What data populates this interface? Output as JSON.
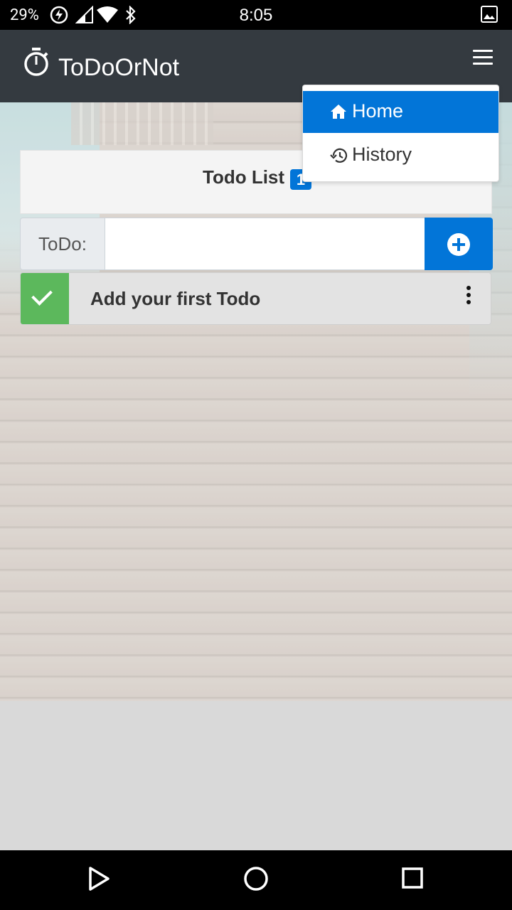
{
  "status_bar": {
    "battery_percent": "29%",
    "time": "8:05",
    "icons": [
      "battery-saver-icon",
      "signal-icon",
      "wifi-icon",
      "bluetooth-icon",
      "image-notification-icon"
    ]
  },
  "app_bar": {
    "icon": "timer-icon",
    "title": "ToDoOrNot",
    "menu_icon": "hamburger-menu-icon"
  },
  "dropdown_menu": {
    "items": [
      {
        "label": "Home",
        "icon": "home-icon",
        "active": true
      },
      {
        "label": "History",
        "icon": "history-icon",
        "active": false
      }
    ]
  },
  "todo_card": {
    "title": "Todo List",
    "badge_count": "1",
    "input_label": "ToDo:",
    "input_value": "",
    "add_button_icon": "plus-circle-icon",
    "todos": [
      {
        "text": "Add your first Todo",
        "checked": true,
        "menu_icon": "kebab-menu-icon"
      }
    ]
  },
  "nav_bar": {
    "buttons": [
      "back-icon",
      "home-circle-icon",
      "recents-icon"
    ]
  },
  "colors": {
    "primary": "#0275d8",
    "success": "#5cb85c",
    "app_bar": "#343a40"
  }
}
